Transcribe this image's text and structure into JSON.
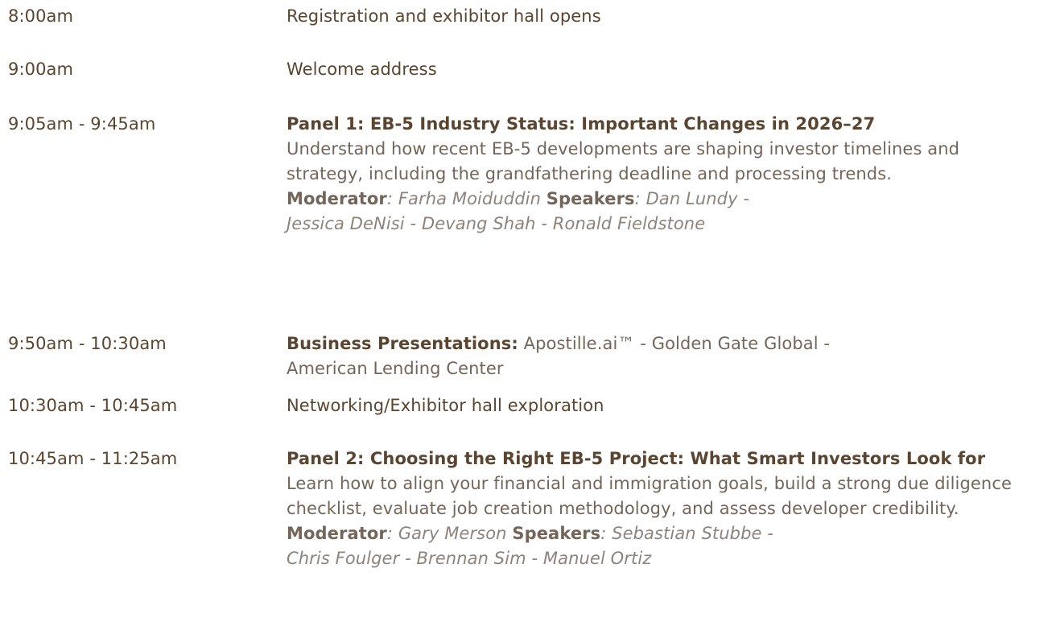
{
  "agenda": {
    "rows": [
      {
        "time": "8:00am",
        "text": "Registration and exhibitor hall opens"
      },
      {
        "time": "9:00am",
        "text": "Welcome address"
      },
      {
        "time": "9:05am - 9:45am",
        "title": "Panel 1: EB-5 Industry Status: Important Changes in 2026–27",
        "description": "Understand how recent EB-5 developments are shaping investor timelines and strategy, including the grandfathering deadline and processing trends.",
        "moderator_label": "Moderator",
        "moderator_sep": ": ",
        "moderator": "Farha Moiduddin",
        "speakers_label": "Speakers",
        "speakers_sep": ": ",
        "speakers_line1": "Dan Lundy -",
        "speakers_line2": "Jessica DeNisi - Devang Shah - Ronald Fieldstone"
      },
      {
        "time": "9:50am - 10:30am",
        "label": "Business Presentations:",
        "items_line1": "Apostille.ai™ - Golden Gate Global -",
        "items_line2": "American Lending Center"
      },
      {
        "time": "10:30am - 10:45am",
        "text": "Networking/Exhibitor hall exploration"
      },
      {
        "time": "10:45am - 11:25am",
        "title": "Panel 2: Choosing the Right EB-5 Project: What Smart Investors Look for",
        "description": "Learn how to align your financial and immigration goals, build a strong due diligence checklist, evaluate job creation methodology, and assess developer credibility.",
        "moderator_label": "Moderator",
        "moderator_sep": ": ",
        "moderator": "Gary Merson",
        "speakers_label": "Speakers",
        "speakers_sep": ": ",
        "speakers_line1": "Sebastian Stubbe -",
        "speakers_line2": "Chris Foulger - Brennan Sim - Manuel Ortiz"
      }
    ]
  }
}
